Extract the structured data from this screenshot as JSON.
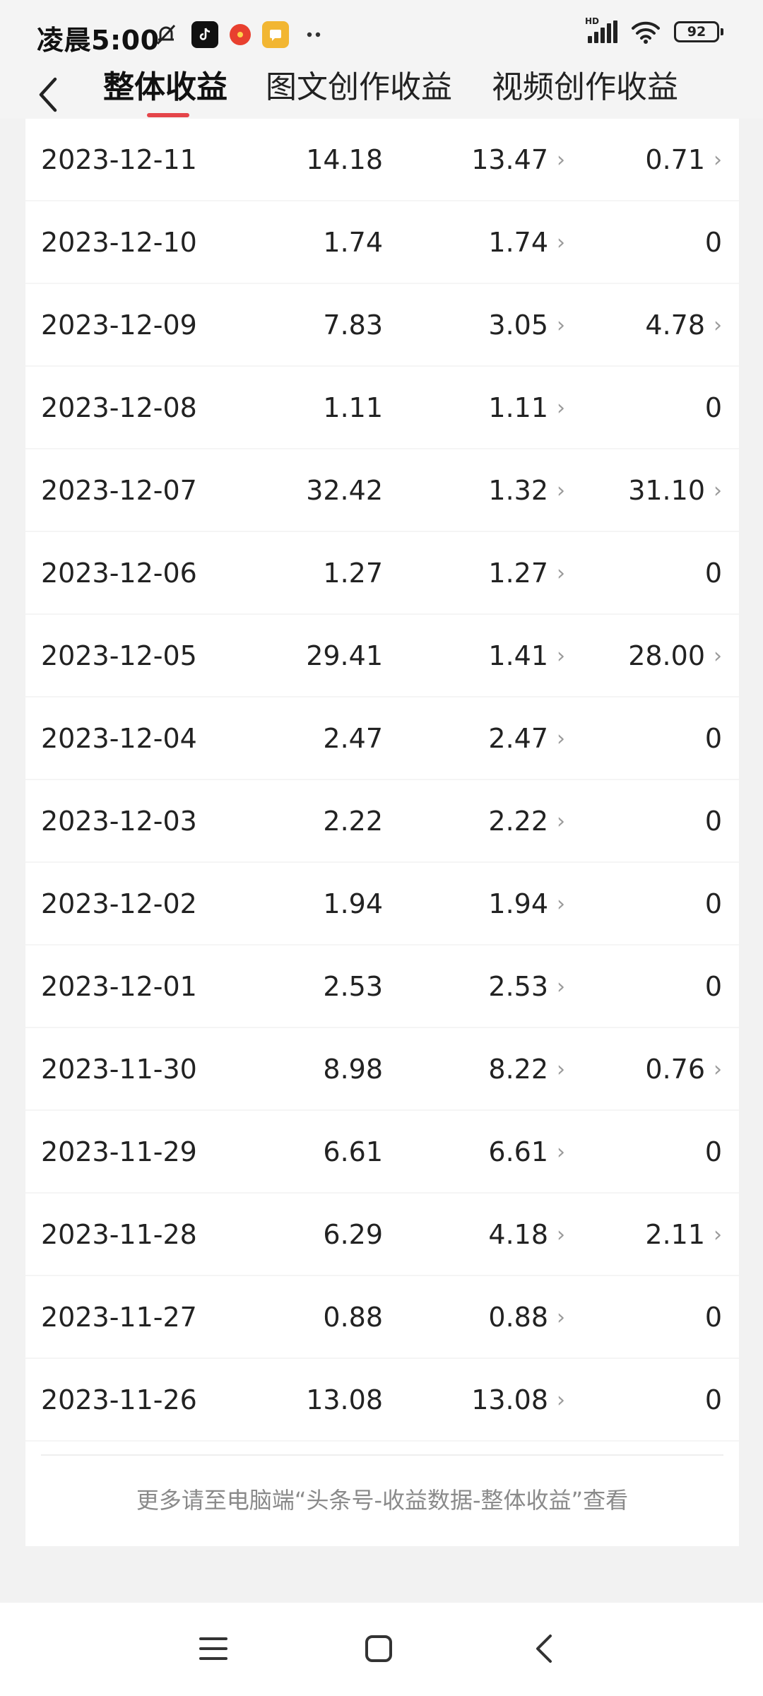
{
  "status_bar": {
    "time": "凌晨5:00",
    "battery": "92",
    "network_label": "HD",
    "icons": [
      "bell-muted-icon",
      "tiktok-icon",
      "news-icon",
      "message-icon",
      "more-dots-icon",
      "signal-icon",
      "wifi-icon",
      "battery-icon"
    ]
  },
  "header": {
    "tabs": [
      {
        "label": "整体收益",
        "active": true
      },
      {
        "label": "图文创作收益",
        "active": false
      },
      {
        "label": "视频创作收益",
        "active": false
      }
    ],
    "accent_color": "#e5454a"
  },
  "rows": [
    {
      "date": "2023-12-11",
      "total": "14.18",
      "article": "13.47",
      "video": "0.71"
    },
    {
      "date": "2023-12-10",
      "total": "1.74",
      "article": "1.74",
      "video": "0"
    },
    {
      "date": "2023-12-09",
      "total": "7.83",
      "article": "3.05",
      "video": "4.78"
    },
    {
      "date": "2023-12-08",
      "total": "1.11",
      "article": "1.11",
      "video": "0"
    },
    {
      "date": "2023-12-07",
      "total": "32.42",
      "article": "1.32",
      "video": "31.10"
    },
    {
      "date": "2023-12-06",
      "total": "1.27",
      "article": "1.27",
      "video": "0"
    },
    {
      "date": "2023-12-05",
      "total": "29.41",
      "article": "1.41",
      "video": "28.00"
    },
    {
      "date": "2023-12-04",
      "total": "2.47",
      "article": "2.47",
      "video": "0"
    },
    {
      "date": "2023-12-03",
      "total": "2.22",
      "article": "2.22",
      "video": "0"
    },
    {
      "date": "2023-12-02",
      "total": "1.94",
      "article": "1.94",
      "video": "0"
    },
    {
      "date": "2023-12-01",
      "total": "2.53",
      "article": "2.53",
      "video": "0"
    },
    {
      "date": "2023-11-30",
      "total": "8.98",
      "article": "8.22",
      "video": "0.76"
    },
    {
      "date": "2023-11-29",
      "total": "6.61",
      "article": "6.61",
      "video": "0"
    },
    {
      "date": "2023-11-28",
      "total": "6.29",
      "article": "4.18",
      "video": "2.11"
    },
    {
      "date": "2023-11-27",
      "total": "0.88",
      "article": "0.88",
      "video": "0"
    },
    {
      "date": "2023-11-26",
      "total": "13.08",
      "article": "13.08",
      "video": "0"
    }
  ],
  "footer_note": "更多请至电脑端“头条号-收益数据-整体收益”查看",
  "nav_bar": {
    "buttons": [
      "menu-icon",
      "home-square-icon",
      "back-chevron-icon"
    ]
  }
}
